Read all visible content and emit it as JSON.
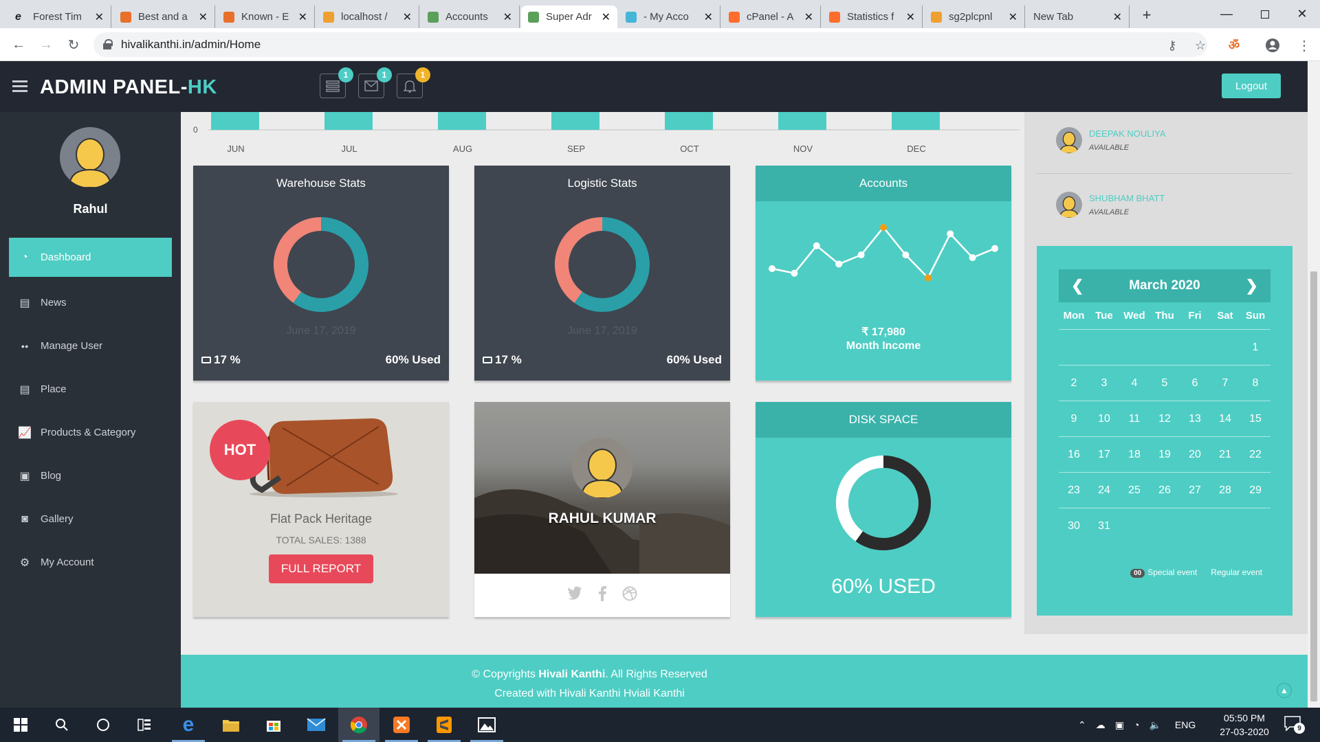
{
  "browser": {
    "tabs": [
      {
        "title": "Forest Tim",
        "favicon_color": "#ffffff",
        "favicon": "edge-icon"
      },
      {
        "title": "Best and a",
        "favicon_color": "#e8702a",
        "favicon": "xampp-icon"
      },
      {
        "title": "Known - E",
        "favicon_color": "#e8702a",
        "favicon": "xampp-icon"
      },
      {
        "title": "localhost /",
        "favicon_color": "#f0a030",
        "favicon": "phpmyadmin-icon"
      },
      {
        "title": "Accounts",
        "favicon_color": "#5aa05a",
        "favicon": "globe-icon"
      },
      {
        "title": "Super Adr",
        "favicon_color": "#5aa05a",
        "favicon": "globe-icon"
      },
      {
        "title": "- My Acco",
        "favicon_color": "#45b5d8",
        "favicon": "swirl-icon"
      },
      {
        "title": "cPanel - A",
        "favicon_color": "#ff6c2c",
        "favicon": "cpanel-icon"
      },
      {
        "title": "Statistics f",
        "favicon_color": "#ff6c2c",
        "favicon": "cpanel-icon"
      },
      {
        "title": "sg2plcpnl",
        "favicon_color": "#f0a030",
        "favicon": "phpmyadmin-icon"
      },
      {
        "title": "New Tab",
        "favicon_color": "",
        "favicon": ""
      }
    ],
    "url": "hivalikanthi.in/admin/Home"
  },
  "header": {
    "brand_main": "ADMIN PANEL-",
    "brand_accent": "HK",
    "badges": [
      "1",
      "1",
      "1"
    ],
    "logout_label": "Logout"
  },
  "sidebar": {
    "user_name": "Rahul",
    "items": [
      {
        "label": "Dashboard",
        "icon": "dashboard-icon"
      },
      {
        "label": "News",
        "icon": "book-icon"
      },
      {
        "label": "Manage User",
        "icon": "users-icon"
      },
      {
        "label": "Place",
        "icon": "book-icon"
      },
      {
        "label": "Products & Category",
        "icon": "chart-icon"
      },
      {
        "label": "Blog",
        "icon": "blog-icon"
      },
      {
        "label": "Gallery",
        "icon": "camera-icon"
      },
      {
        "label": "My Account",
        "icon": "gears-icon"
      }
    ]
  },
  "chart_data": [
    {
      "type": "bar",
      "categories": [
        "JUN",
        "JUL",
        "AUG",
        "SEP",
        "OCT",
        "NOV",
        "DEC"
      ],
      "ytick_visible": "0"
    },
    {
      "type": "pie",
      "title": "Warehouse Stats",
      "slices": [
        {
          "label": "used",
          "value": 60,
          "color": "#2a9fa8"
        },
        {
          "label": "other",
          "value": 40,
          "color": "#f08578"
        }
      ]
    },
    {
      "type": "pie",
      "title": "Logistic Stats",
      "slices": [
        {
          "label": "used",
          "value": 60,
          "color": "#2a9fa8"
        },
        {
          "label": "other",
          "value": 40,
          "color": "#f08578"
        }
      ]
    },
    {
      "type": "line",
      "title": "Accounts",
      "values": [
        3,
        2.5,
        5.5,
        3.5,
        4.5,
        7.5,
        4.5,
        2,
        6.8,
        4.2,
        5.2
      ]
    },
    {
      "type": "pie",
      "title": "DISK SPACE",
      "slices": [
        {
          "label": "used",
          "value": 60,
          "color": "#2b2b2b"
        },
        {
          "label": "free",
          "value": 40,
          "color": "#ffffff"
        }
      ]
    }
  ],
  "warehouse": {
    "title": "Warehouse Stats",
    "date": "June 17, 2019",
    "percent": "17 %",
    "used": "60% Used"
  },
  "logistic": {
    "title": "Logistic Stats",
    "date": "June 17, 2019",
    "percent": "17 %",
    "used": "60% Used"
  },
  "accounts": {
    "title": "Accounts",
    "amount": "₹ 17,980",
    "caption": "Month Income"
  },
  "product": {
    "badge": "HOT",
    "name": "Flat Pack Heritage",
    "sales": "TOTAL SALES: 1388",
    "button": "FULL REPORT"
  },
  "profile": {
    "name": "RAHUL KUMAR"
  },
  "disk": {
    "title": "DISK SPACE",
    "used_label": "60% USED"
  },
  "people": [
    {
      "name": "DEEPAK NOULIYA",
      "status": "AVAILABLE"
    },
    {
      "name": "SHUBHAM BHATT",
      "status": "AVAILABLE"
    }
  ],
  "calendar": {
    "month": "March 2020",
    "weekdays": [
      "Mon",
      "Tue",
      "Wed",
      "Thu",
      "Fri",
      "Sat",
      "Sun"
    ],
    "weeks": [
      [
        "",
        "",
        "",
        "",
        "",
        "",
        "1"
      ],
      [
        "2",
        "3",
        "4",
        "5",
        "6",
        "7",
        "8"
      ],
      [
        "9",
        "10",
        "11",
        "12",
        "13",
        "14",
        "15"
      ],
      [
        "16",
        "17",
        "18",
        "19",
        "20",
        "21",
        "22"
      ],
      [
        "23",
        "24",
        "25",
        "26",
        "27",
        "28",
        "29"
      ],
      [
        "30",
        "31",
        "",
        "",
        "",
        "",
        ""
      ]
    ],
    "legend_badge": "00",
    "legend_special": "Special event",
    "legend_regular": "Regular event"
  },
  "footer": {
    "prefix": "© Copyrights ",
    "company": "Hivali Kanthi",
    "suffix": ". All Rights Reserved",
    "line2": "Created with Hivali Kanthi Hviali Kanthi"
  },
  "taskbar": {
    "language": "ENG",
    "time": "05:50 PM",
    "date": "27-03-2020",
    "notification_count": "9"
  },
  "colors": {
    "accent": "#4ecdc4",
    "dark_panel": "#3f4650",
    "header": "#222731",
    "sidebar": "#2a3038",
    "hot": "#e8495a"
  }
}
